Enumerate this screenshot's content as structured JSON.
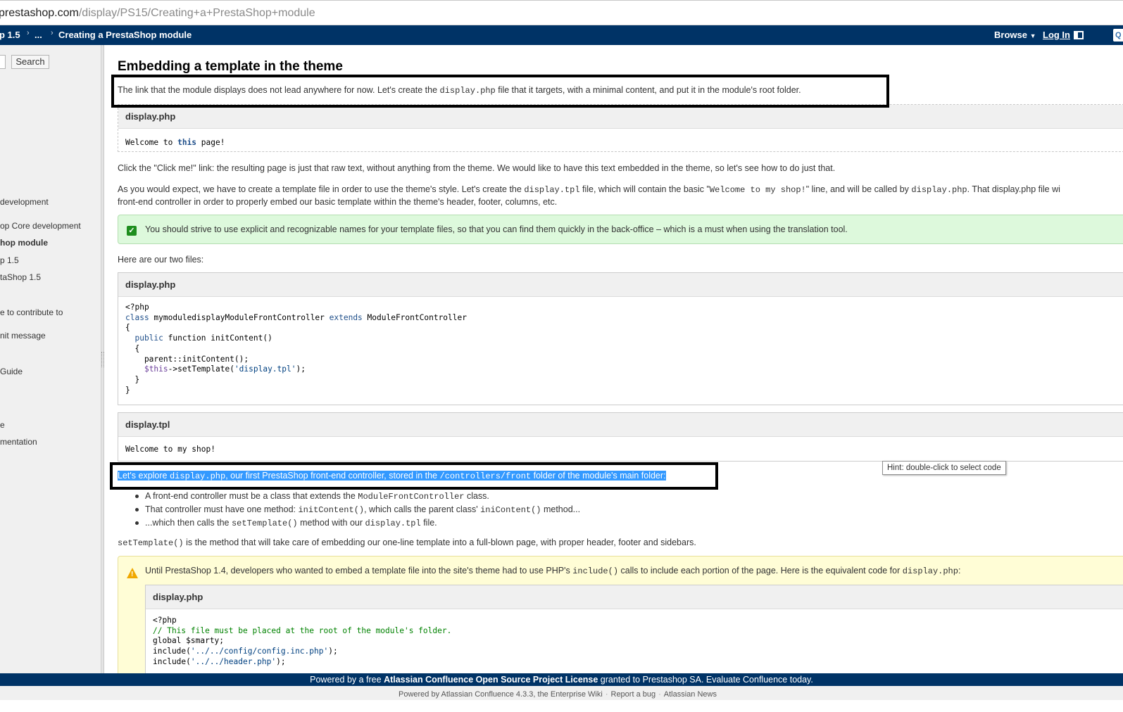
{
  "browser": {
    "url_host": "prestashop.com",
    "url_path": "/display/PS15/Creating+a+PrestaShop+module"
  },
  "topbar": {
    "crumb_1": "p 1.5",
    "crumb_2": "...",
    "crumb_3": "Creating a PrestaShop module",
    "browse_label": "Browse",
    "login_label": "Log In",
    "search_icon_label": "Q"
  },
  "sidebar": {
    "search_button": "Search",
    "items": [
      {
        "label": "development",
        "bold": false
      },
      {
        "label": "op Core development",
        "bold": false
      },
      {
        "label": "hop module",
        "bold": true
      },
      {
        "label": "p 1.5",
        "bold": false
      },
      {
        "label": "taShop 1.5",
        "bold": false
      },
      {
        "label": "e to contribute to",
        "bold": false
      },
      {
        "label": "nit message",
        "bold": false
      },
      {
        "label": "Guide",
        "bold": false
      },
      {
        "label": "e",
        "bold": false
      },
      {
        "label": "mentation",
        "bold": false
      }
    ]
  },
  "content": {
    "heading": "Embedding a template in the theme",
    "intro_a": "The link that the module displays does not lead anywhere for now. Let's create the ",
    "intro_code": "display.php",
    "intro_b": " file that it targets, with a minimal content, and put it in the module's root folder.",
    "code1_title": "display.php",
    "code1_a": "Welcome to ",
    "code1_kw": "this",
    "code1_b": " page!",
    "para_click": "Click the \"Click me!\" link: the resulting page is just that raw text, without anything from the theme. We would like to have this text embedded in the theme, so let's see how to do just that.",
    "para_expect_a": "As you would expect, we have to create a template file in order to use the theme's style. Let's create the ",
    "para_expect_code1": "display.tpl",
    "para_expect_b": " file, which will contain the basic \"",
    "para_expect_code2": "Welcome to my shop!",
    "para_expect_c": "\" line, and will be called by ",
    "para_expect_code3": "display.php",
    "para_expect_d": ". That display.php file wi",
    "para_expect_line2": "front-end controller in order to properly embed our basic template within the theme's header, footer, columns, etc.",
    "tip_text": "You should strive to use explicit and recognizable names for your template files, so that you can find them quickly in the back-office – which is a must when using the translation tool.",
    "two_files": "Here are our two files:",
    "code2_title": "display.php",
    "code2_lines": {
      "l1": "<?php",
      "l2_kw": "class",
      "l2_a": " mymoduledisplayModuleFrontController ",
      "l2_kw2": "extends",
      "l2_b": " ModuleFrontController",
      "l3": "{",
      "l4_kw": "public",
      "l4_a": " function initContent()",
      "l5": "  {",
      "l6": "    parent::initContent();",
      "l7_var": "$this",
      "l7_a": "->setTemplate(",
      "l7_str": "'display.tpl'",
      "l7_b": ");",
      "l8": "  }",
      "l9": "}"
    },
    "code3_title": "display.tpl",
    "code3_body": "Welcome to my shop!",
    "explore_a": "Let's explore ",
    "explore_code1": "display.php",
    "explore_b": ", our first PrestaShop front-end controller, stored in the ",
    "explore_code2": "/controllers/front",
    "explore_c": " folder of the module's main folder:",
    "bullet1_a": "A front-end controller must be a class that extends the ",
    "bullet1_code": "ModuleFrontController",
    "bullet1_b": " class.",
    "bullet2_a": "That controller must have one method: ",
    "bullet2_code1": "initContent()",
    "bullet2_b": ", which calls the parent class' ",
    "bullet2_code2": "iniContent()",
    "bullet2_c": " method...",
    "bullet3_a": "...which then calls the ",
    "bullet3_code1": "setTemplate()",
    "bullet3_b": " method with our ",
    "bullet3_code2": "display.tpl",
    "bullet3_c": " file.",
    "settemplate_code": "setTemplate()",
    "settemplate_text": " is the method that will take care of embedding our one-line template into a full-blown page, with proper header, footer and sidebars.",
    "warn_a": "Until PrestaShop 1.4, developers who wanted to embed a template file into the site's theme had to use PHP's ",
    "warn_code1": "include()",
    "warn_b": " calls to include each portion of the page. Here is the equivalent code for ",
    "warn_code2": "display.php",
    "warn_c": ":",
    "code4_title": "display.php",
    "code4_l1": "<?php",
    "code4_l2": "// This file must be placed at the root of the module's folder.",
    "code4_l3": "global $smarty;",
    "code4_l4_a": "include(",
    "code4_l4_str": "'../../config/config.inc.php'",
    "code4_l4_b": ");",
    "code4_l5_a": "include(",
    "code4_l5_str": "'../../header.php'",
    "code4_l5_b": ");",
    "hint": "Hint: double-click to select code"
  },
  "footer": {
    "line1_a": "Powered by a free ",
    "line1_bold": "Atlassian Confluence Open Source Project License",
    "line1_b": " granted to Prestashop SA. Evaluate Confluence today.",
    "line2_powered": "Powered by Atlassian Confluence 4.3.3, the Enterprise Wiki",
    "line2_bug": "Report a bug",
    "line2_news": "Atlassian News"
  },
  "colors": {
    "topbar_bg": "#003366",
    "tip_bg": "#ddf9dc",
    "warning_bg": "#fffdd6",
    "selection": "#3399ff"
  }
}
